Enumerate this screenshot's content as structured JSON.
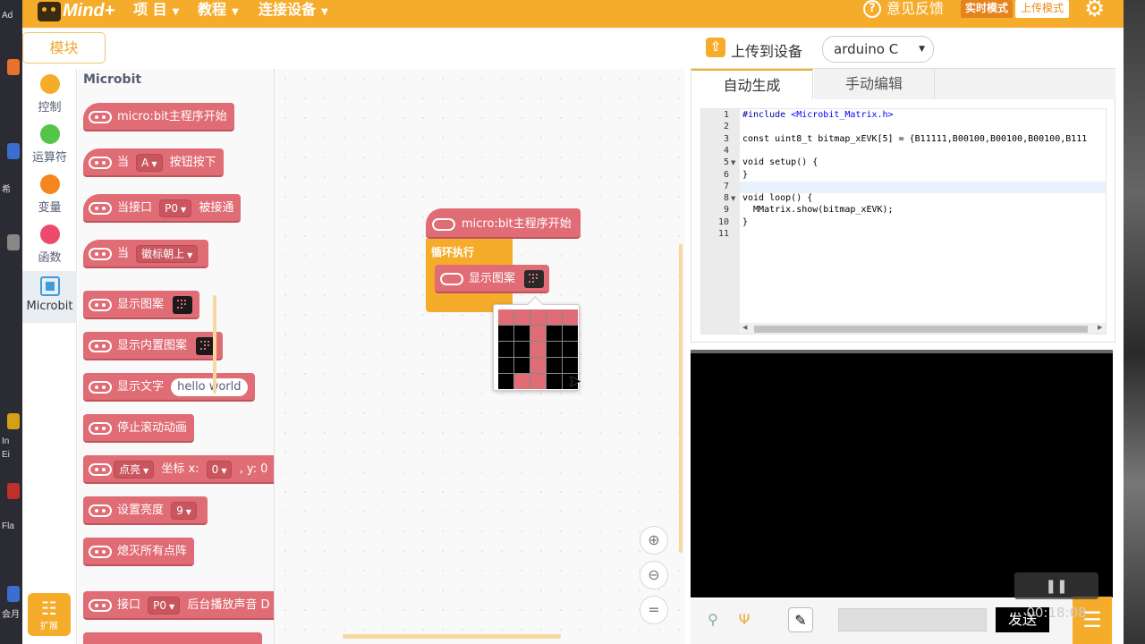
{
  "desktop": {
    "left_texts": [
      "Ad",
      "希",
      "In",
      "Ei",
      "Fla",
      "会月"
    ]
  },
  "app": {
    "logo_text": "Mind+",
    "menus": [
      {
        "label": "项 目"
      },
      {
        "label": "教程"
      },
      {
        "label": "连接设备"
      }
    ],
    "feedback": {
      "icon": "question-circle-icon",
      "label": "意见反馈"
    },
    "mode_realtime": "实时模式",
    "mode_upload": "上传模式",
    "settings_icon": "gear-icon"
  },
  "toolbar": {
    "modules_tab": "模块",
    "upload_label": "上传到设备",
    "board_selected": "arduino C"
  },
  "categories": [
    {
      "label": "控制",
      "color": "#f6ac2b"
    },
    {
      "label": "运算符",
      "color": "#55c549"
    },
    {
      "label": "变量",
      "color": "#f4861d"
    },
    {
      "label": "函数",
      "color": "#eb4c6e"
    },
    {
      "label": "Microbit",
      "color": "#3f9be0"
    }
  ],
  "extension_label": "扩展",
  "flyout": {
    "title": "Microbit",
    "blocks": {
      "main_start": "micro:bit主程序开始",
      "when_button": {
        "prefix": "当",
        "option": "A",
        "suffix": "按钮按下"
      },
      "when_pin": {
        "prefix": "当接口",
        "option": "P0",
        "suffix": "被接通"
      },
      "when_gesture": {
        "prefix": "当",
        "option": "徽标朝上"
      },
      "show_pattern": "显示图案",
      "show_builtin": "显示内置图案",
      "show_text": {
        "label": "显示文字",
        "value": "hello world"
      },
      "stop_scroll": "停止滚动动画",
      "plot": {
        "option": "点亮",
        "coord_label": "坐标 x:",
        "x": "0",
        "y_label": ", y:",
        "y": "0"
      },
      "brightness": {
        "label": "设置亮度",
        "value": "9"
      },
      "clear": "熄灭所有点阵",
      "pin_sound": {
        "prefix": "接口",
        "option": "P0",
        "suffix": "后台播放声音",
        "tail": "D"
      }
    }
  },
  "workspace": {
    "hat_label": "micro:bit主程序开始",
    "loop_label": "循环执行",
    "show_label": "显示图案",
    "matrix": [
      [
        1,
        1,
        1,
        1,
        1
      ],
      [
        0,
        0,
        1,
        0,
        0
      ],
      [
        0,
        0,
        1,
        0,
        0
      ],
      [
        0,
        0,
        1,
        0,
        0
      ],
      [
        0,
        1,
        1,
        0,
        0
      ]
    ]
  },
  "code_panel": {
    "tabs": [
      "自动生成",
      "手动编辑"
    ],
    "line_numbers": [
      "1",
      "2",
      "3",
      "4",
      "5",
      "6",
      "7",
      "8",
      "9",
      "10",
      "11"
    ],
    "lines": [
      "#include <Microbit_Matrix.h>",
      "",
      "const uint8_t bitmap_xEVK[5] = {B11111,B00100,B00100,B00100,B111",
      "",
      "void setup() {",
      "}",
      "",
      "void loop() {",
      "  MMatrix.show(bitmap_xEVK);",
      "}",
      ""
    ]
  },
  "serial": {
    "send_label": "发送",
    "input_value": ""
  },
  "recording_timer": "00:18:08"
}
